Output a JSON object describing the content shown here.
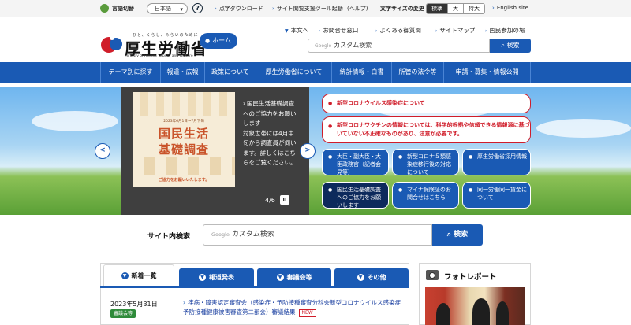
{
  "topbar": {
    "lang_label": "言語切替",
    "lang_value": "日本語",
    "help": "?",
    "links": [
      "点字ダウンロード",
      "サイト閲覧支援ツール起動",
      "(ヘルプ)"
    ],
    "size_label": "文字サイズの変更",
    "sizes": [
      "標準",
      "大",
      "特大"
    ],
    "english": "English site"
  },
  "header": {
    "tagline": "ひと、くらし、みらいのために",
    "logo": "厚生労働省",
    "logo_en": "Ministry of Health, Labour and Welfare",
    "home": "ホーム",
    "links": [
      "本文へ",
      "お問合せ窓口",
      "よくある御質問",
      "サイトマップ",
      "国民参加の場"
    ],
    "search_brand": "Google",
    "search_placeholder": "カスタム検索",
    "search_button": "検索"
  },
  "nav": [
    "テーマ別に探す",
    "報道・広報",
    "政策について",
    "厚生労働省について",
    "統計情報・白書",
    "所管の法令等",
    "申請・募集・情報公開"
  ],
  "hero": {
    "poster_small": "2023年6月1日〜7月下旬",
    "poster_title1": "国民生活",
    "poster_title2": "基礎調査",
    "poster_foot": "ご協力をお願いいたします。",
    "slide_lines": [
      "国民生活基礎調査へのご協力をお願いします",
      "対象世帯には4月中旬から調査員が伺います。詳しくはこちらをご覧ください。"
    ],
    "counter": "4/6",
    "pause": "II",
    "prev": "<",
    "next": ">",
    "alerts": [
      "新型コロナウイルス感染症について",
      "新型コロナワクチンの情報については、科学的根拠や信頼できる情報源に基づいていない不正確なものがあり、注意が必要です。"
    ],
    "quick": [
      "大臣・副大臣・大臣政務官（記者会見等）",
      "新型コロナ５類感染症移行後の対応について",
      "厚生労働省採用情報",
      "国民生活基礎調査へのご協力をお願いします",
      "マイナ保険証のお問合せはこちら",
      "同一労働同一賃金について"
    ]
  },
  "site_search": {
    "label": "サイト内検索",
    "brand": "Google",
    "placeholder": "カスタム検索",
    "button": "検索"
  },
  "news": {
    "tabs": [
      "新着一覧",
      "報道発表",
      "審議会等",
      "その他"
    ],
    "date": "2023年5月31日",
    "badge": "審議会等",
    "item": "疾病・障害認定審査会（感染症・予防接種審査分科会新型コロナウイルス感染症予防接種健康被害審査第二部会）審議結果",
    "new": "NEW"
  },
  "photo": {
    "title": "フォトレポート"
  },
  "colors": {
    "brand_blue": "#1a5ab4",
    "alert_red": "#d01d2a",
    "badge_green": "#2e8b3a"
  }
}
